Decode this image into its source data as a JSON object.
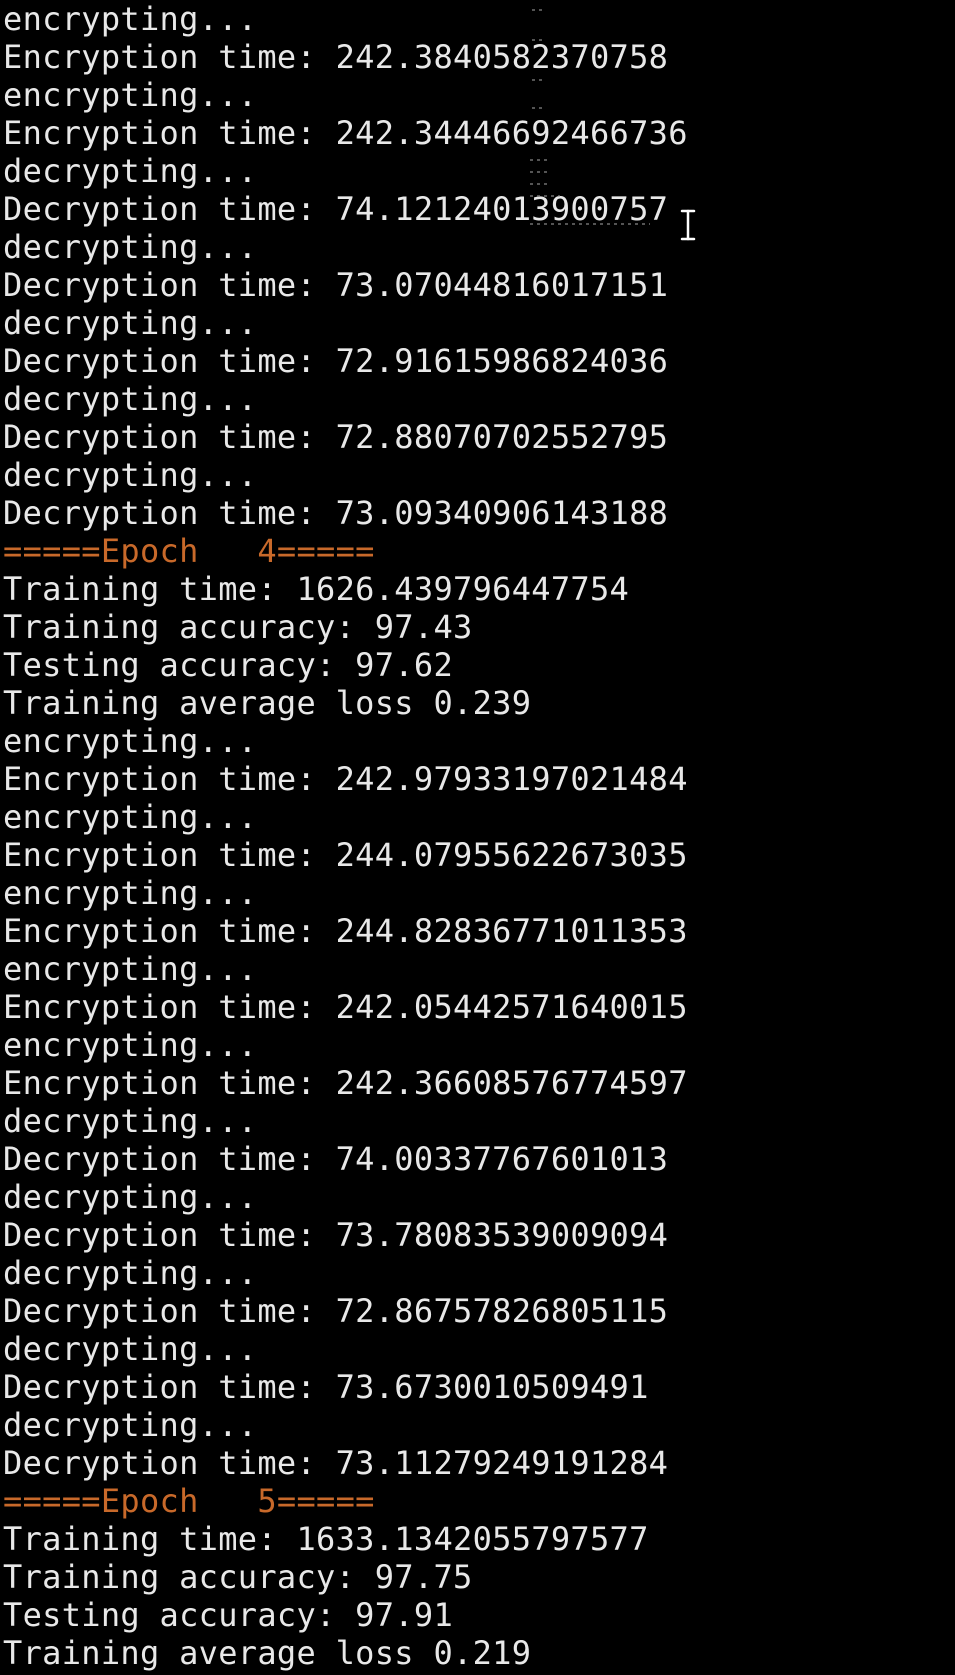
{
  "terminal": {
    "lines": [
      {
        "text": "encrypting...",
        "kind": "normal"
      },
      {
        "text": "Encryption time: 242.3840582370758",
        "kind": "normal"
      },
      {
        "text": "encrypting...",
        "kind": "normal"
      },
      {
        "text": "Encryption time: 242.34446692466736",
        "kind": "normal"
      },
      {
        "text": "decrypting...",
        "kind": "normal"
      },
      {
        "text": "Decryption time: 74.12124013900757",
        "kind": "normal"
      },
      {
        "text": "decrypting...",
        "kind": "normal"
      },
      {
        "text": "Decryption time: 73.07044816017151",
        "kind": "normal"
      },
      {
        "text": "decrypting...",
        "kind": "normal"
      },
      {
        "text": "Decryption time: 72.91615986824036",
        "kind": "normal"
      },
      {
        "text": "decrypting...",
        "kind": "normal"
      },
      {
        "text": "Decryption time: 72.88070702552795",
        "kind": "normal"
      },
      {
        "text": "decrypting...",
        "kind": "normal"
      },
      {
        "text": "Decryption time: 73.09340906143188",
        "kind": "normal"
      },
      {
        "text": "=====Epoch   4=====",
        "kind": "epoch"
      },
      {
        "text": "Training time: 1626.439796447754",
        "kind": "normal"
      },
      {
        "text": "Training accuracy: 97.43",
        "kind": "normal"
      },
      {
        "text": "Testing accuracy: 97.62",
        "kind": "normal"
      },
      {
        "text": "Training average loss 0.239",
        "kind": "normal"
      },
      {
        "text": "encrypting...",
        "kind": "normal"
      },
      {
        "text": "Encryption time: 242.97933197021484",
        "kind": "normal"
      },
      {
        "text": "encrypting...",
        "kind": "normal"
      },
      {
        "text": "Encryption time: 244.07955622673035",
        "kind": "normal"
      },
      {
        "text": "encrypting...",
        "kind": "normal"
      },
      {
        "text": "Encryption time: 244.82836771011353",
        "kind": "normal"
      },
      {
        "text": "encrypting...",
        "kind": "normal"
      },
      {
        "text": "Encryption time: 242.05442571640015",
        "kind": "normal"
      },
      {
        "text": "encrypting...",
        "kind": "normal"
      },
      {
        "text": "Encryption time: 242.36608576774597",
        "kind": "normal"
      },
      {
        "text": "decrypting...",
        "kind": "normal"
      },
      {
        "text": "Decryption time: 74.00337767601013",
        "kind": "normal"
      },
      {
        "text": "decrypting...",
        "kind": "normal"
      },
      {
        "text": "Decryption time: 73.78083539009094",
        "kind": "normal"
      },
      {
        "text": "decrypting...",
        "kind": "normal"
      },
      {
        "text": "Decryption time: 72.86757826805115",
        "kind": "normal"
      },
      {
        "text": "decrypting...",
        "kind": "normal"
      },
      {
        "text": "Decryption time: 73.6730010509491",
        "kind": "normal"
      },
      {
        "text": "decrypting...",
        "kind": "normal"
      },
      {
        "text": "Decryption time: 73.11279249191284",
        "kind": "normal"
      },
      {
        "text": "=====Epoch   5=====",
        "kind": "epoch"
      },
      {
        "text": "Training time: 1633.1342055797577",
        "kind": "normal"
      },
      {
        "text": "Training accuracy: 97.75",
        "kind": "normal"
      },
      {
        "text": "Testing accuracy: 97.91",
        "kind": "normal"
      },
      {
        "text": "Training average loss 0.219",
        "kind": "normal"
      }
    ]
  },
  "colors": {
    "background": "#000000",
    "text": "#e8e8e8",
    "epoch": "#c8692a"
  },
  "icons": {
    "cursor": "text-cursor-icon"
  }
}
